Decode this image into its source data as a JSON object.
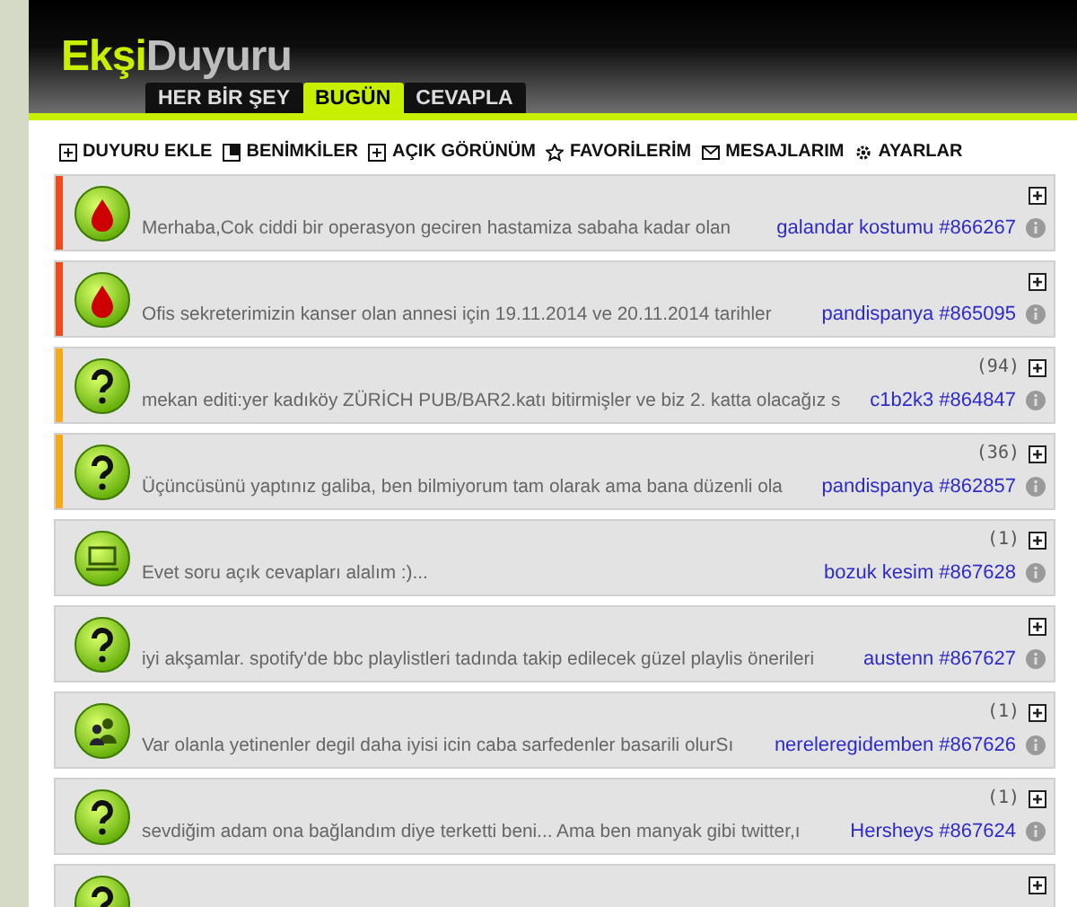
{
  "logo": {
    "part_1": "Ekşi",
    "part_2": "Duyuru"
  },
  "tabs": [
    {
      "label": "HER BİR ŞEY",
      "selected": false
    },
    {
      "label": "BUGÜN",
      "selected": true
    },
    {
      "label": "CEVAPLA",
      "selected": false
    }
  ],
  "toolbar": [
    {
      "label": "DUYURU EKLE"
    },
    {
      "label": "BENİMKİLER"
    },
    {
      "label": "AÇIK GÖRÜNÜM"
    },
    {
      "label": "FAVORİLERİM"
    },
    {
      "label": "MESAJLARIM"
    },
    {
      "label": "AYARLAR"
    }
  ],
  "posts": [
    {
      "kind": "blood",
      "color": "#f04a1c",
      "text": "Merhaba,Cok ciddi bir operasyon geciren hastamiza sabaha kadar olan",
      "author": "galandar kostumu #866267"
    },
    {
      "kind": "blood",
      "color": "#f04a1c",
      "text": "Ofis sekreterimizin kanser olan annesi için 19.11.2014 ve 20.11.2014 tarihler",
      "author": "pandispanya #865095"
    },
    {
      "kind": "question",
      "color": "#f7a81b",
      "count": "(94)",
      "text": "mekan editi:yer kadıköy ZÜRİCH PUB/BAR2.katı bitirmişler ve biz 2. katta olacağız s",
      "author": "c1b2k3 #864847"
    },
    {
      "kind": "question",
      "color": "#f7a81b",
      "count": "(36)",
      "text": "Üçüncüsünü yaptınız galiba, ben bilmiyorum tam olarak ama bana düzenli ola",
      "author": "pandispanya #862857"
    },
    {
      "kind": "computer",
      "count": "(1)",
      "text": "Evet soru açık cevapları alalım :)...",
      "author": "bozuk kesim #867628"
    },
    {
      "kind": "question",
      "text": "iyi akşamlar. spotify'de bbc playlistleri tadında takip edilecek güzel playlis önerileri",
      "author": "austenn #867627"
    },
    {
      "kind": "people",
      "count": "(1)",
      "text": "Var olanla yetinenler degil daha iyisi icin caba sarfedenler basarili olurSı",
      "author": "nereleregidemben #867626"
    },
    {
      "kind": "question",
      "count": "(1)",
      "text": "sevdiğim adam ona bağlandım diye terketti beni... Ama ben manyak gibi twitter,ı",
      "author": "Hersheys #867624"
    },
    {
      "kind": "question"
    }
  ]
}
